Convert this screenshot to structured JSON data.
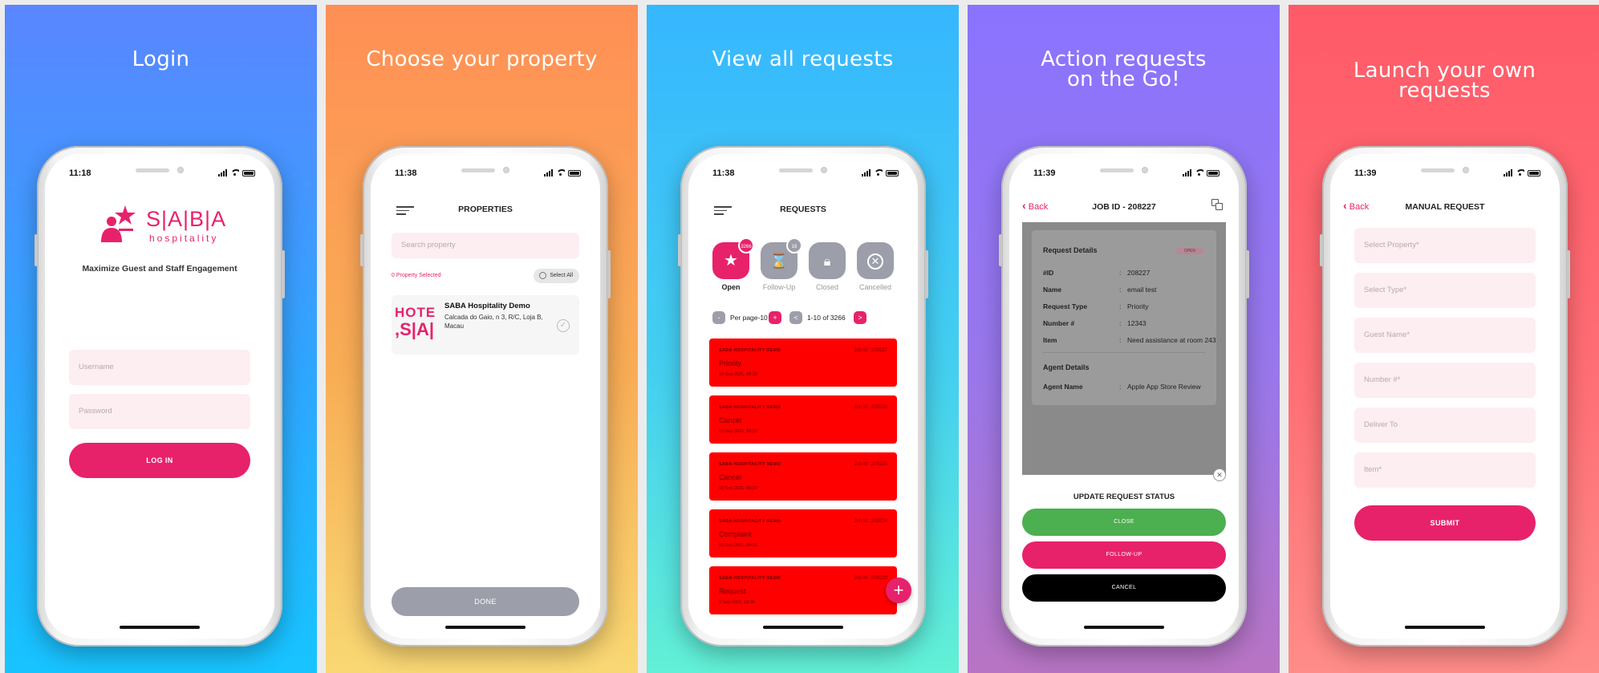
{
  "colors": {
    "brand": "#e8216b",
    "open_red": "#ff0000",
    "grey": "#9c9ea9",
    "green": "#4caf50",
    "black": "#000000"
  },
  "panels": [
    {
      "headline": [
        "Login"
      ],
      "time": "11:18",
      "brand_name": "S|A|B|A",
      "brand_sub": "hospitality",
      "tagline": "Maximize Guest and Staff Engagement",
      "username_placeholder": "Username",
      "password_placeholder": "Password",
      "login_label": "LOG IN"
    },
    {
      "headline": [
        "Choose your property"
      ],
      "time": "11:38",
      "title": "PROPERTIES",
      "search_placeholder": "Search property",
      "selected_text": "0 Property Selected",
      "select_all": "Select All",
      "property": {
        "logo_top": "HOTE",
        "logo_bottom": ",S|A|",
        "name": "SABA Hospitality Demo",
        "address": "Calcada do Gaio, n 3, R/C, Loja B, Macau"
      },
      "done_label": "DONE"
    },
    {
      "headline": [
        "View all requests"
      ],
      "time": "11:38",
      "title": "REQUESTS",
      "statuses": [
        {
          "label": "Open",
          "badge": "3266",
          "icon": "star-icon"
        },
        {
          "label": "Follow-Up",
          "badge": "16",
          "icon": "hourglass-icon"
        },
        {
          "label": "Closed",
          "badge": "",
          "icon": "lock-icon"
        },
        {
          "label": "Cancelled",
          "badge": "",
          "icon": "x-icon"
        }
      ],
      "per_page": "Per page-10",
      "range": "1-10 of 3266",
      "minus": "-",
      "plus": "+",
      "prev": "<",
      "next": ">",
      "requests": [
        {
          "company": "SABA HOSPITALITY DEMO",
          "job": "Job Id : 208227",
          "type": "Priority",
          "date": "10 Sep 2021, 09:32"
        },
        {
          "company": "SABA HOSPITALITY DEMO",
          "job": "Job Id : 208228",
          "type": "Cancel",
          "date": "10 Sep 2021, 09:32"
        },
        {
          "company": "SABA HOSPITALITY DEMO",
          "job": "Job Id : 208225",
          "type": "Cancel",
          "date": "10 Sep 2021, 09:32"
        },
        {
          "company": "SABA HOSPITALITY DEMO",
          "job": "Job Id : 208224",
          "type": "Complaint",
          "date": "10 Sep 2021, 09:31"
        },
        {
          "company": "SABA HOSPITALITY DEMO",
          "job": "Job Id : 208223",
          "type": "Request",
          "date": "9 Sep 2021, 18:36"
        }
      ],
      "fab": "+"
    },
    {
      "headline": [
        "Action requests",
        "on the Go!"
      ],
      "time": "11:39",
      "back": "Back",
      "title": "JOB ID - 208227",
      "section_request": "Request Details",
      "open_tag": "OPEN",
      "details": [
        {
          "k": "#ID",
          "v": "208227"
        },
        {
          "k": "Name",
          "v": "email test"
        },
        {
          "k": "Request Type",
          "v": "Priority"
        },
        {
          "k": "Number #",
          "v": "12343"
        },
        {
          "k": "Item",
          "v": "Need assistance at room 243"
        }
      ],
      "section_agent": "Agent Details",
      "agent": {
        "k": "Agent Name",
        "v": "Apple App Store Review"
      },
      "update_title": "UPDATE REQUEST STATUS",
      "btn_close": "CLOSE",
      "btn_follow": "FOLLOW-UP",
      "btn_cancel": "CANCEL"
    },
    {
      "headline": [
        "Launch your own",
        "requests"
      ],
      "time": "11:39",
      "back": "Back",
      "title": "MANUAL REQUEST",
      "fields": [
        "Select Property*",
        "Select Type*",
        "Guest Name*",
        "Number #*",
        "Deliver To",
        "Item*"
      ],
      "submit": "SUBMIT"
    }
  ]
}
